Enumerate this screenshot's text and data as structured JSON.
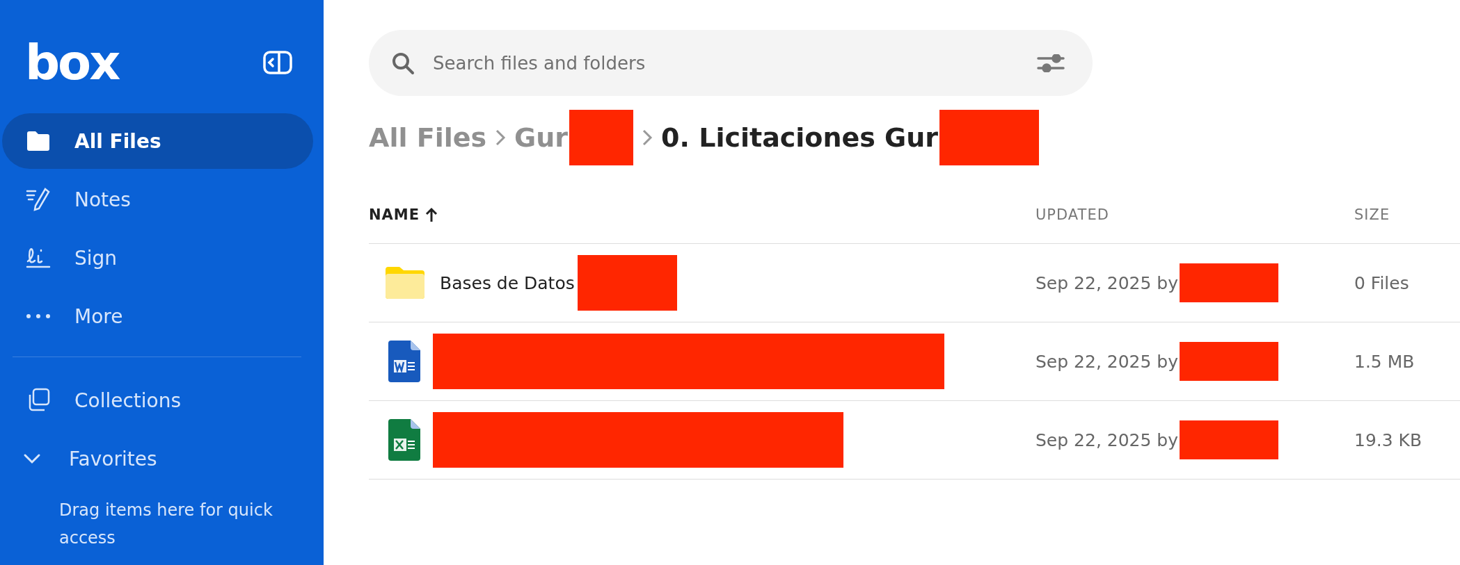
{
  "sidebar": {
    "logo": "box",
    "items": [
      {
        "label": "All Files",
        "selected": true
      },
      {
        "label": "Notes",
        "selected": false
      },
      {
        "label": "Sign",
        "selected": false
      },
      {
        "label": "More",
        "selected": false
      }
    ],
    "sections": [
      {
        "label": "Collections"
      },
      {
        "label": "Favorites",
        "expanded": true,
        "hint": "Drag items here for quick access"
      }
    ]
  },
  "search": {
    "placeholder": "Search files and folders"
  },
  "breadcrumb": [
    {
      "label": "All Files",
      "redacted": false,
      "current": false
    },
    {
      "label": "Gur",
      "redacted": true,
      "current": false
    },
    {
      "label": "0. Licitaciones Gur",
      "redacted": true,
      "current": true
    }
  ],
  "table": {
    "columns": [
      {
        "label": "NAME",
        "sorted": true
      },
      {
        "label": "UPDATED",
        "sorted": false
      },
      {
        "label": "SIZE",
        "sorted": false
      }
    ],
    "rows": [
      {
        "kind": "folder",
        "name": "Bases de Datos",
        "name_redacted": true,
        "updated": "Sep 22, 2025 by",
        "updated_redacted": true,
        "size": "0 Files"
      },
      {
        "kind": "word",
        "name_redacted": true,
        "updated": "Sep 22, 2025 by",
        "updated_redacted": true,
        "size": "1.5 MB"
      },
      {
        "kind": "excel",
        "name_redacted": true,
        "updated": "Sep 22, 2025 by",
        "updated_redacted": true,
        "size": "19.3 KB"
      }
    ]
  }
}
